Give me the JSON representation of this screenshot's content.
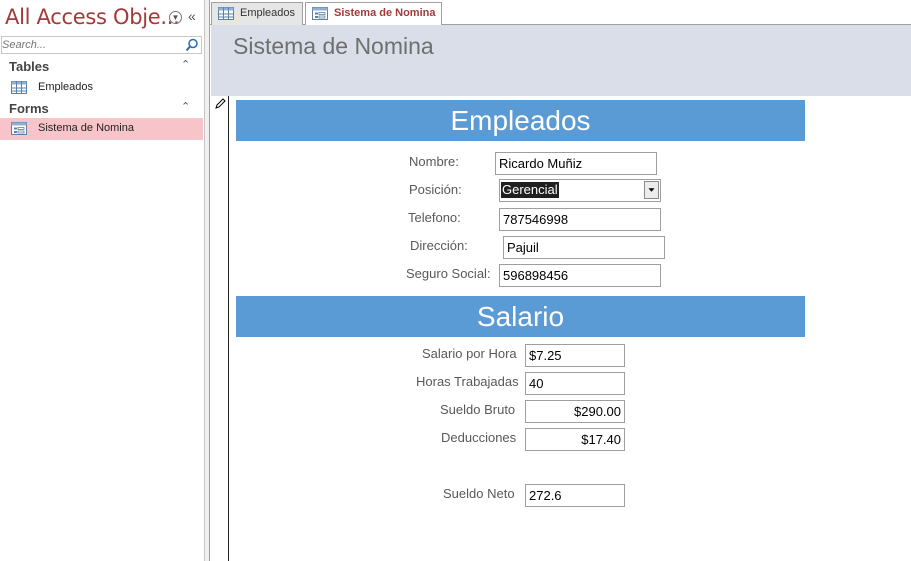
{
  "nav": {
    "title": "All Access Obje...",
    "search_placeholder": "Search...",
    "groups": [
      {
        "label": "Tables",
        "items": [
          {
            "label": "Empleados",
            "icon": "table-icon"
          }
        ]
      },
      {
        "label": "Forms",
        "items": [
          {
            "label": "Sistema de Nomina",
            "icon": "form-icon",
            "selected": true
          }
        ]
      }
    ]
  },
  "tabs": [
    {
      "label": "Empleados",
      "icon": "table-icon",
      "active": false
    },
    {
      "label": "Sistema de Nomina",
      "icon": "form-icon",
      "active": true
    }
  ],
  "form": {
    "title": "Sistema de Nomina",
    "sections": {
      "empleados": "Empleados",
      "salario": "Salario"
    },
    "fields": {
      "nombre": {
        "label": "Nombre:",
        "value": "Ricardo Muñiz"
      },
      "posicion": {
        "label": "Posición:",
        "value": "Gerencial"
      },
      "telefono": {
        "label": "Telefono:",
        "value": "787546998"
      },
      "direccion": {
        "label": "Dirección:",
        "value": "Pajuil"
      },
      "seguro_social": {
        "label": "Seguro Social:",
        "value": "596898456"
      },
      "salario_hora": {
        "label": "Salario por Hora",
        "value": "$7.25"
      },
      "horas": {
        "label": "Horas Trabajadas",
        "value": "40"
      },
      "sueldo_bruto": {
        "label": "Sueldo Bruto",
        "value": "$290.00"
      },
      "deducciones": {
        "label": "Deducciones",
        "value": "$17.40"
      },
      "sueldo_neto": {
        "label": "Sueldo Neto",
        "value": "272.6"
      }
    }
  },
  "colors": {
    "section_band": "#5b9bd5",
    "header_bg": "#d9dee8",
    "title_accent": "#a33a3a",
    "selected_item_bg": "#f7c5c9"
  }
}
